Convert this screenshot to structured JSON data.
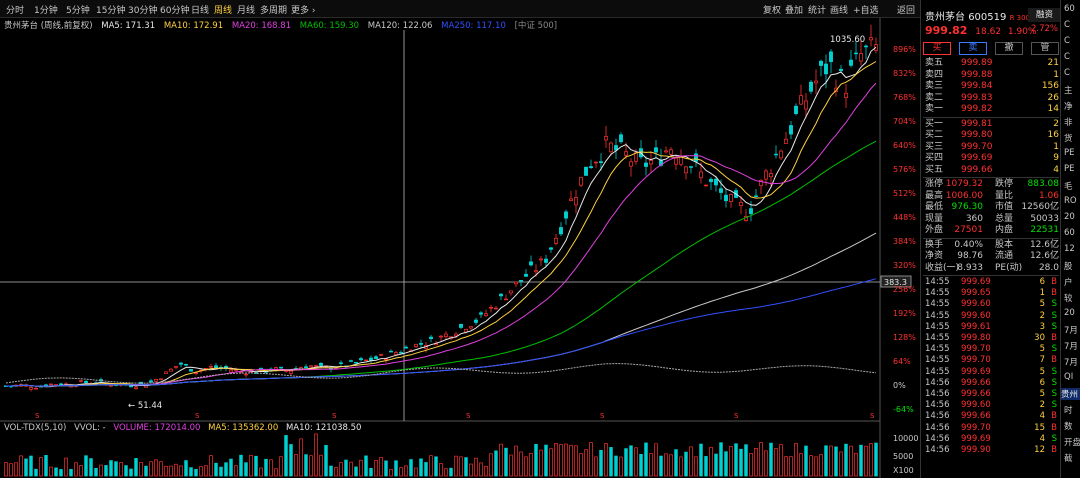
{
  "toolbar": {
    "periods": [
      "分时",
      "1分钟",
      "5分钟",
      "15分钟",
      "30分钟",
      "60分钟",
      "日线",
      "周线",
      "月线",
      "多周期",
      "更多 ›"
    ],
    "active_period": "周线",
    "right_items": [
      "复权",
      "叠加",
      "统计",
      "画线",
      "+自选",
      "返回"
    ]
  },
  "chart_title": "贵州茅台 (周线,前复权)",
  "ma": [
    {
      "label": "MA5: 171.31",
      "color": "#e8e8e8"
    },
    {
      "label": "MA10: 172.91",
      "color": "#ffd23f"
    },
    {
      "label": "MA20: 168.81",
      "color": "#e040e0"
    },
    {
      "label": "MA60: 159.30",
      "color": "#00c000"
    },
    {
      "label": "MA120: 122.06",
      "color": "#c8c8c8"
    },
    {
      "label": "MA250: 117.10",
      "color": "#3050ff"
    }
  ],
  "index_tag": "[中证 500]",
  "high_label": "1035.60",
  "low_label": "51.44",
  "cursor_price": "383.3",
  "y_axis": [
    "896%",
    "832%",
    "768%",
    "704%",
    "640%",
    "576%",
    "512%",
    "448%",
    "384%",
    "320%",
    "256%",
    "192%",
    "128%",
    "64%",
    "0%",
    "-64%"
  ],
  "vol_legend": {
    "name": "VOL-TDX(5,10)",
    "vvol": "VVOL: -",
    "volume": "VOLUME: 172014.00",
    "ma5": "MA5: 135362.00",
    "ma10": "MA10: 121038.50"
  },
  "vol_axis": [
    "10000",
    "5000",
    "X100"
  ],
  "stock": {
    "name": "贵州茅台",
    "code": "600519",
    "tag": "R 300",
    "price": "999.82",
    "change": "18.62",
    "pct": "1.90%",
    "badge": "融资",
    "badge_pct": "2.72%"
  },
  "trade_buttons": [
    "买",
    "卖",
    "撤",
    "管"
  ],
  "sell_orders": [
    {
      "label": "卖五",
      "price": "999.89",
      "qty": "21"
    },
    {
      "label": "卖四",
      "price": "999.88",
      "qty": "1"
    },
    {
      "label": "卖三",
      "price": "999.84",
      "qty": "156"
    },
    {
      "label": "卖二",
      "price": "999.83",
      "qty": "26"
    },
    {
      "label": "卖一",
      "price": "999.82",
      "qty": "14"
    }
  ],
  "buy_orders": [
    {
      "label": "买一",
      "price": "999.81",
      "qty": "2"
    },
    {
      "label": "买二",
      "price": "999.80",
      "qty": "16"
    },
    {
      "label": "买三",
      "price": "999.70",
      "qty": "1"
    },
    {
      "label": "买四",
      "price": "999.69",
      "qty": "9"
    },
    {
      "label": "买五",
      "price": "999.66",
      "qty": "4"
    }
  ],
  "stats": [
    {
      "k1": "涨停",
      "v1": "1079.32",
      "k2": "跌停",
      "v2": "883.08",
      "c1": "up",
      "c2": "dn"
    },
    {
      "k1": "最高",
      "v1": "1006.00",
      "k2": "量比",
      "v2": "1.06",
      "c1": "up",
      "c2": "up"
    },
    {
      "k1": "最低",
      "v1": "976.30",
      "k2": "市值",
      "v2": "12560亿",
      "c1": "dn",
      "c2": "wht"
    },
    {
      "k1": "现量",
      "v1": "360",
      "k2": "总量",
      "v2": "50033",
      "c1": "wht",
      "c2": "wht"
    },
    {
      "k1": "外盘",
      "v1": "27501",
      "k2": "内盘",
      "v2": "22531",
      "c1": "up",
      "c2": "dn"
    },
    {
      "k1": "换手",
      "v1": "0.40%",
      "k2": "股本",
      "v2": "12.6亿",
      "c1": "wht",
      "c2": "wht"
    },
    {
      "k1": "净资",
      "v1": "98.76",
      "k2": "流通",
      "v2": "12.6亿",
      "c1": "wht",
      "c2": "wht"
    },
    {
      "k1": "收益(一)",
      "v1": "8.933",
      "k2": "PE(动)",
      "v2": "28.0",
      "c1": "wht",
      "c2": "wht"
    }
  ],
  "ticks": [
    {
      "time": "14:55",
      "price": "999.69",
      "vol": "6",
      "bs": "B"
    },
    {
      "time": "14:55",
      "price": "999.65",
      "vol": "1",
      "bs": "B"
    },
    {
      "time": "14:55",
      "price": "999.60",
      "vol": "5",
      "bs": "S"
    },
    {
      "time": "14:55",
      "price": "999.60",
      "vol": "2",
      "bs": "S"
    },
    {
      "time": "14:55",
      "price": "999.61",
      "vol": "3",
      "bs": "S"
    },
    {
      "time": "14:55",
      "price": "999.80",
      "vol": "30",
      "bs": "B"
    },
    {
      "time": "14:55",
      "price": "999.70",
      "vol": "5",
      "bs": "S"
    },
    {
      "time": "14:55",
      "price": "999.70",
      "vol": "7",
      "bs": "B"
    },
    {
      "time": "14:55",
      "price": "999.69",
      "vol": "5",
      "bs": "S"
    },
    {
      "time": "14:56",
      "price": "999.66",
      "vol": "6",
      "bs": "S"
    },
    {
      "time": "14:56",
      "price": "999.66",
      "vol": "5",
      "bs": "S"
    },
    {
      "time": "14:56",
      "price": "999.60",
      "vol": "2",
      "bs": "S"
    },
    {
      "time": "14:56",
      "price": "999.66",
      "vol": "4",
      "bs": "B"
    },
    {
      "time": "14:56",
      "price": "999.70",
      "vol": "15",
      "bs": "B"
    },
    {
      "time": "14:56",
      "price": "999.69",
      "vol": "4",
      "bs": "S"
    },
    {
      "time": "14:56",
      "price": "999.90",
      "vol": "12",
      "bs": "B"
    }
  ],
  "far_panel": [
    "60",
    "C",
    "C",
    "C",
    "C",
    "主",
    "净",
    "非",
    "货",
    "PE",
    "PE",
    "毛",
    "RO",
    "20",
    "60",
    "12",
    "股",
    "户",
    "较",
    "20",
    "7月",
    "7月",
    "7月",
    "QI",
    "贵州",
    "时",
    "数",
    "开盘",
    "截"
  ],
  "chart_data": {
    "type": "candlestick",
    "y_unit": "%",
    "ylim": [
      -64,
      896
    ],
    "series_trend_pct": [
      0,
      2,
      -2,
      6,
      4,
      10,
      8,
      4,
      2,
      6,
      30,
      60,
      40,
      50,
      45,
      38,
      40,
      44,
      42,
      55,
      48,
      52,
      60,
      70,
      80,
      95,
      110,
      120,
      140,
      160,
      180,
      220,
      260,
      300,
      330,
      420,
      520,
      600,
      640,
      620,
      590,
      600,
      640,
      610,
      560,
      520,
      480,
      470,
      560,
      640,
      720,
      800,
      860,
      800,
      880,
      900
    ]
  }
}
